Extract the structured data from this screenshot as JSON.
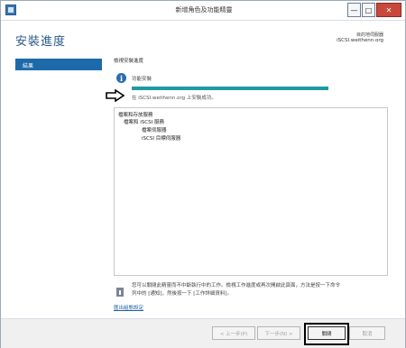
{
  "window": {
    "title": "新增角色及功能精靈",
    "controls": {
      "minimize": "—",
      "maximize": "□",
      "close": "✕"
    }
  },
  "header": {
    "title": "安裝進度",
    "destination_label": "目的地伺服器",
    "destination_server": "iSCSI.weithenn.org"
  },
  "nav": {
    "items": [
      {
        "label": "結果",
        "selected": true
      }
    ]
  },
  "content": {
    "section_label": "檢視安裝進度",
    "status_text": "功能安裝",
    "progress_percent": 100,
    "progress_color": "#1f9aa2",
    "success_message": "在 iSCSI.weithenn.org 上安裝成功。",
    "results": [
      "檔案和存放服務",
      "檔案和 iSCSI 服務",
      "檔案伺服器",
      "iSCSI 目標伺服器"
    ],
    "note_line1": "您可以關閉此精靈而不中斷執行中的工作。檢視工作進度或再次開啟此頁面，方法是按一下命令",
    "note_line2": "列中的 [通知]，然後按一下 [工作詳細資料]。",
    "export_link": "匯出組態設定"
  },
  "footer": {
    "prev": "< 上一步(P)",
    "next": "下一步(N) >",
    "close": "關閉",
    "cancel": "取消"
  },
  "colors": {
    "accent": "#1d6aaa",
    "title_blue": "#2a5a8a"
  }
}
